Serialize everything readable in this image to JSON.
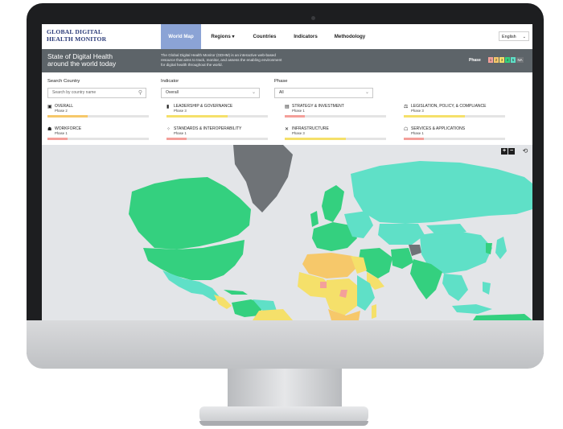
{
  "header": {
    "logo_line1": "GLOBAL DIGITAL",
    "logo_line2": "HEALTH MONITOR",
    "nav": [
      "World Map",
      "Regions ▾",
      "Countries",
      "Indicators",
      "Methodology"
    ],
    "active_nav": "World Map",
    "language": "English"
  },
  "banner": {
    "title_line1": "State of Digital Health",
    "title_line2": "around the world today",
    "description_line1": "The Global Digital Health Monitor (GDHM) is an interactive web-based",
    "description_line2": "resource that aims to track, monitor, and assess the enabling environment",
    "description_line3": "for digital health throughout the world.",
    "phase_label": "Phase",
    "phase_boxes": [
      "1",
      "2",
      "3",
      "4",
      "5",
      "NA"
    ]
  },
  "filters": {
    "search_label": "Search Country",
    "search_placeholder": "Search by country name",
    "indicator_label": "Indicator",
    "indicator_value": "Overall",
    "phase_label": "Phase",
    "phase_value": "All"
  },
  "indicators": [
    {
      "name": "OVERALL",
      "phase": "Phase 2",
      "fill": 0.4,
      "icon": "overall-icon"
    },
    {
      "name": "LEADERSHIP & GOVERNANCE",
      "phase": "Phase 3",
      "fill": 0.6,
      "icon": "chart-icon"
    },
    {
      "name": "STRATEGY & INVESTMENT",
      "phase": "Phase 1",
      "fill": 0.2,
      "icon": "document-icon"
    },
    {
      "name": "LEGISLATION, POLICY, & COMPLIANCE",
      "phase": "Phase 3",
      "fill": 0.6,
      "icon": "scale-icon"
    },
    {
      "name": "WORKFORCE",
      "phase": "Phase 1",
      "fill": 0.2,
      "icon": "workforce-icon"
    },
    {
      "name": "STANDARDS & INTEROPERABILITY",
      "phase": "Phase 1",
      "fill": 0.2,
      "icon": "standards-icon"
    },
    {
      "name": "INFRASTRUCTURE",
      "phase": "Phase 3",
      "fill": 0.6,
      "icon": "tools-icon"
    },
    {
      "name": "SERVICES & APPLICATIONS",
      "phase": "Phase 1",
      "fill": 0.2,
      "icon": "services-icon"
    }
  ],
  "map_controls": {
    "zoom_in": "+",
    "zoom_out": "−",
    "reset": "⟲"
  },
  "colors": {
    "phase1": "#f4a09a",
    "phase2": "#f6c86a",
    "phase3": "#f5e06a",
    "phase4": "#34d07f",
    "phase5": "#5fe0c7",
    "na": "#6f7377",
    "nav_active": "#8ba3d5",
    "banner": "#5d6469"
  }
}
